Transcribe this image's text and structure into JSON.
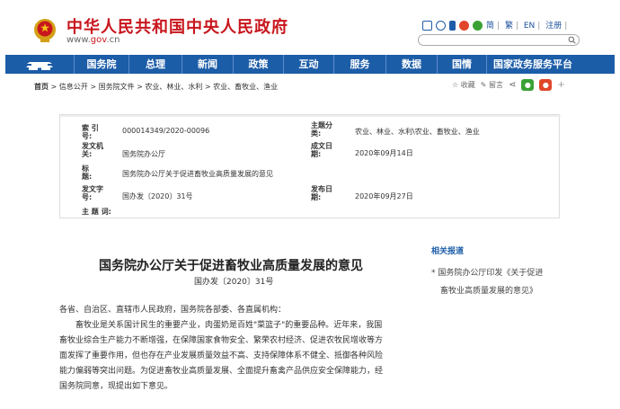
{
  "header": {
    "title": "中华人民共和国中央人民政府",
    "url_prefix": "www.",
    "url_bold": "gov",
    "url_suffix": ".cn",
    "lang_links": [
      "简",
      "繁",
      "EN",
      "注册"
    ]
  },
  "nav": {
    "items": [
      "国务院",
      "总理",
      "新闻",
      "政策",
      "互动",
      "服务",
      "数据",
      "国情",
      "国家政务服务平台"
    ]
  },
  "breadcrumb": {
    "home": "首页",
    "path": " > 信息公开 > 国务院文件 > 农业、林业、水利 > 农业、畜牧业、渔业",
    "favorite": "☆ 收藏",
    "comment": "留言"
  },
  "info": {
    "index_label": "索 引 号:",
    "index_value": "000014349/2020-00096",
    "category_label": "主题分类:",
    "category_value": "农业、林业、水利\\农业、畜牧业、渔业",
    "issuer_label": "发文机关:",
    "issuer_value": "国务院办公厅",
    "date_label": "成文日期:",
    "date_value": "2020年09月14日",
    "title_label": "标　　题:",
    "title_value": "国务院办公厅关于促进畜牧业高质量发展的意见",
    "docno_label": "发文字号:",
    "docno_value": "国办发〔2020〕31号",
    "pubdate_label": "发布日期:",
    "pubdate_value": "2020年09月27日",
    "keywords_label": "主 题 词:"
  },
  "document": {
    "title": "国务院办公厅关于促进畜牧业高质量发展的意见",
    "number": "国办发〔2020〕31号",
    "salutation": "各省、自治区、直辖市人民政府，国务院各部委、各直属机构：",
    "lines": [
      "畜牧业是关系国计民生的重要产业，肉蛋奶是百姓\"菜篮子\"的重要品种。近年来，我国",
      "畜牧业综合生产能力不断增强，在保障国家食物安全、繁荣农村经济、促进农牧民增收等方",
      "面发挥了重要作用，但也存在产业发展质量效益不高、支持保障体系不健全、抵御各种风险",
      "能力偏弱等突出问题。为促进畜牧业高质量发展、全面提升畜禽产品供应安全保障能力，经",
      "国务院同意，现提出如下意见。"
    ]
  },
  "related": {
    "title": "相关报道",
    "link_line1": "* 国务院办公厅印发《关于促进",
    "link_line2": "畜牧业高质量发展的意见》"
  },
  "colors": {
    "brand_red": "#c8161d",
    "nav_blue": "#1c5da8"
  }
}
